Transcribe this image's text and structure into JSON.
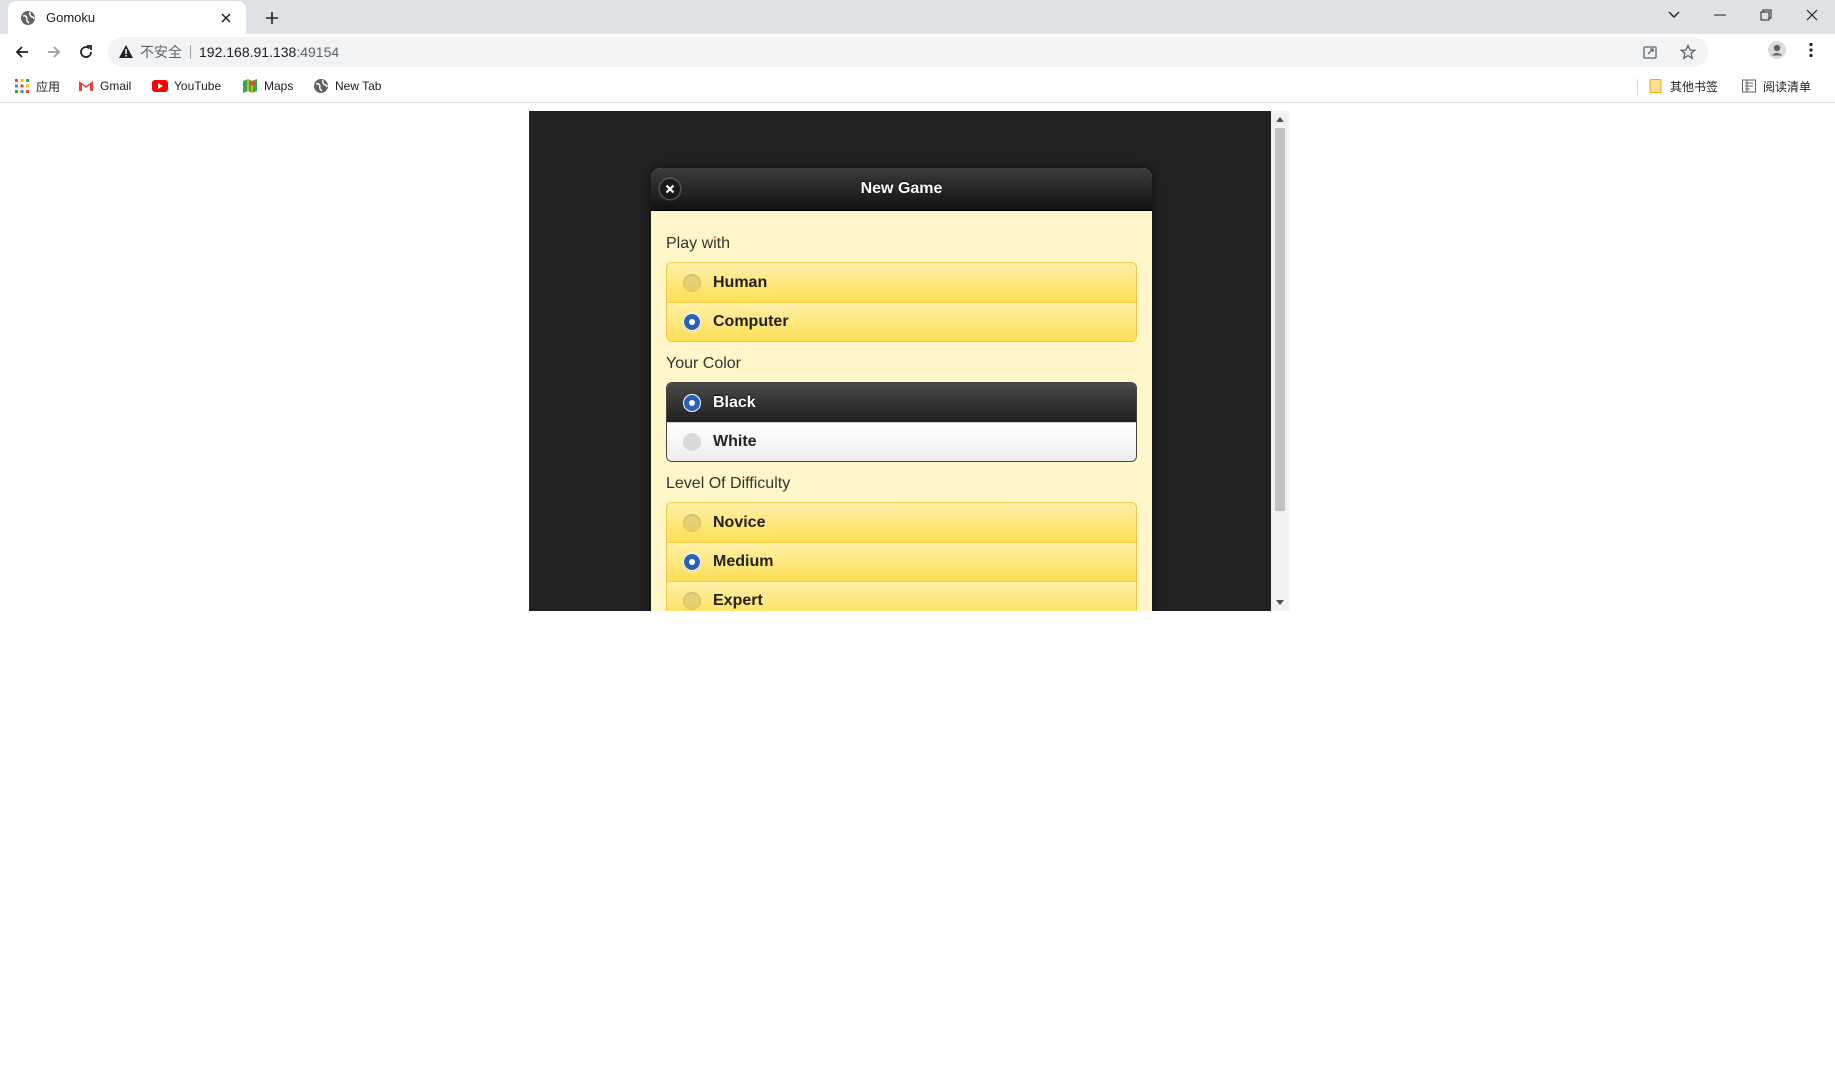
{
  "browser": {
    "tab_title": "Gomoku",
    "security_label": "不安全",
    "url_host": "192.168.91.138",
    "url_port": ":49154"
  },
  "bookmarks": {
    "apps": "应用",
    "gmail": "Gmail",
    "youtube": "YouTube",
    "maps": "Maps",
    "new_tab": "New Tab",
    "other": "其他书签",
    "reading_list": "阅读清单"
  },
  "dialog": {
    "title": "New Game",
    "play_with_label": "Play with",
    "play_with_options": [
      "Human",
      "Computer"
    ],
    "play_with_selected": "Computer",
    "color_label": "Your Color",
    "color_options": [
      "Black",
      "White"
    ],
    "color_selected": "Black",
    "difficulty_label": "Level Of Difficulty",
    "difficulty_options": [
      "Novice",
      "Medium",
      "Expert"
    ],
    "difficulty_selected": "Medium"
  },
  "colors": {
    "accent_radio": "#2b60b6",
    "option_yellow": "#fddf56",
    "dialog_bg": "#fff6c9",
    "page_bg": "#222222"
  }
}
